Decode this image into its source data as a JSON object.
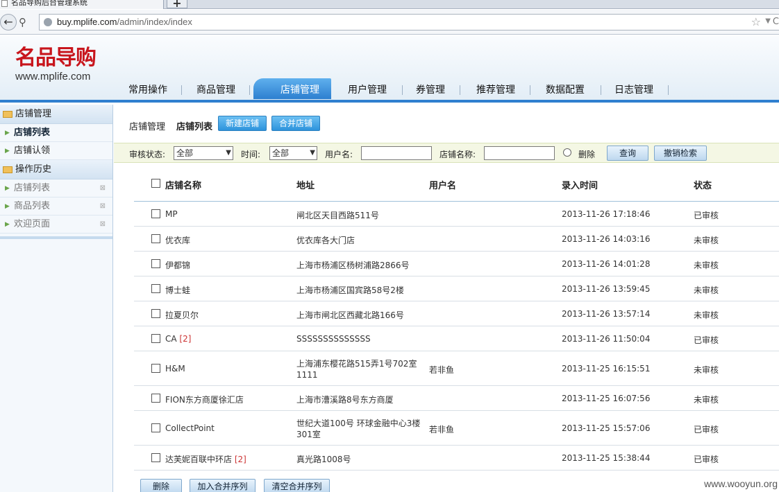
{
  "browser": {
    "tab_title": "名品导购后台管理系统",
    "newtab_label": "+",
    "url_host": "buy.mplife.com",
    "url_path": "/admin/index/index"
  },
  "header": {
    "logo_text": "名品导购",
    "logo_url": "www.mplife.com",
    "nav": [
      {
        "label": "常用操作"
      },
      {
        "label": "商品管理"
      },
      {
        "label": "店铺管理",
        "active": true
      },
      {
        "label": "用户管理"
      },
      {
        "label": "券管理"
      },
      {
        "label": "推荐管理"
      },
      {
        "label": "数据配置"
      },
      {
        "label": "日志管理"
      }
    ]
  },
  "sidebar": {
    "section1": "店铺管理",
    "items1": [
      "店铺列表",
      "店铺认领"
    ],
    "section2": "操作历史",
    "history": [
      "店铺列表",
      "商品列表",
      "欢迎页面"
    ]
  },
  "content": {
    "crumb": "店铺管理",
    "crumb_current": "店铺列表",
    "new_shop_btn": "新建店铺",
    "merge_shop_btn": "合并店铺"
  },
  "filters": {
    "audit_label": "审核状态:",
    "audit_value": "全部",
    "time_label": "时间:",
    "time_value": "全部",
    "username_label": "用户名:",
    "shopname_label": "店铺名称:",
    "deleted_label": "删除",
    "search_btn": "查询",
    "reset_btn": "撤销检索"
  },
  "table": {
    "headers": {
      "name": "店铺名称",
      "address": "地址",
      "user": "用户名",
      "time": "录入时间",
      "status": "状态"
    },
    "rows": [
      {
        "name": "MP",
        "tag": "",
        "address": "闸北区天目西路511号",
        "address2": "",
        "user": "",
        "time": "2013-11-26 17:18:46",
        "status": "已审核"
      },
      {
        "name": "优衣库",
        "tag": "",
        "address": "优衣库各大门店",
        "address2": "",
        "user": "",
        "time": "2013-11-26 14:03:16",
        "status": "未审核"
      },
      {
        "name": "伊都锦",
        "tag": "",
        "address": "上海市杨浦区杨树浦路2866号",
        "address2": "",
        "user": "",
        "time": "2013-11-26 14:01:28",
        "status": "未审核"
      },
      {
        "name": "博士蛙",
        "tag": "",
        "address": "上海市杨浦区国宾路58号2楼",
        "address2": "",
        "user": "",
        "time": "2013-11-26 13:59:45",
        "status": "未审核"
      },
      {
        "name": "拉夏贝尔",
        "tag": "",
        "address": "上海市闸北区西藏北路166号",
        "address2": "",
        "user": "",
        "time": "2013-11-26 13:57:14",
        "status": "未审核"
      },
      {
        "name": "CA",
        "tag": "[2]",
        "address": "SSSSSSSSSSSSSS",
        "address2": "",
        "user": "",
        "time": "2013-11-26 11:50:04",
        "status": "已审核"
      },
      {
        "name": "H&M",
        "tag": "",
        "address": "上海浦东樱花路515弄1号702室",
        "address2": "1111",
        "user": "若非鱼",
        "time": "2013-11-25 16:15:51",
        "status": "未审核"
      },
      {
        "name": "FION东方商厦徐汇店",
        "tag": "",
        "address": "上海市漕溪路8号东方商厦",
        "address2": "",
        "user": "",
        "time": "2013-11-25 16:07:56",
        "status": "未审核"
      },
      {
        "name": "CollectPoint",
        "tag": "",
        "address": "世纪大道100号 环球金融中心3楼",
        "address2": "301室",
        "user": "若非鱼",
        "time": "2013-11-25 15:57:06",
        "status": "已审核"
      },
      {
        "name": "达芙妮百联中环店",
        "tag": "[2]",
        "address": "真光路1008号",
        "address2": "",
        "user": "",
        "time": "2013-11-25 15:38:44",
        "status": "已审核"
      }
    ]
  },
  "bottom_actions": {
    "delete_btn": "删除",
    "add_merge_btn": "加入合并序列",
    "clear_merge_btn": "清空合并序列"
  },
  "watermark": "www.wooyun.org"
}
